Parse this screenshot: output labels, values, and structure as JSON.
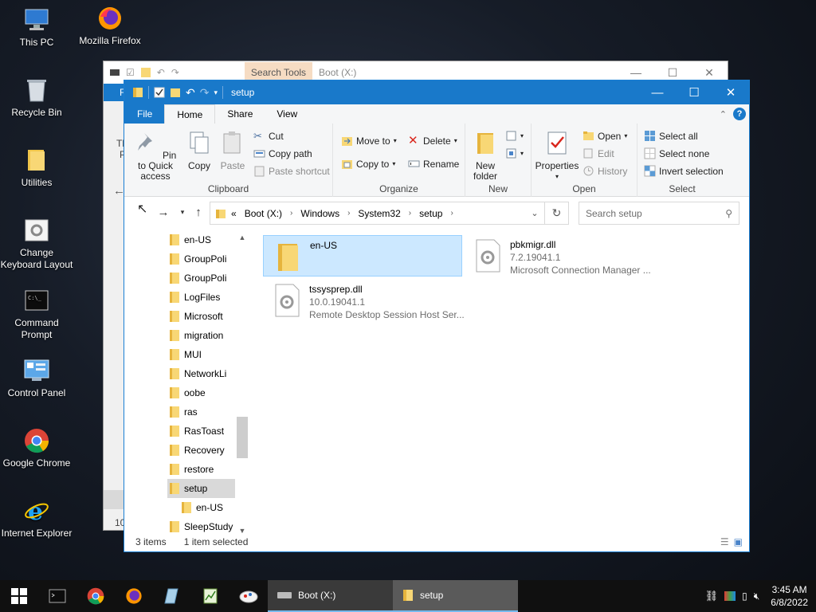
{
  "desktop": {
    "icons": [
      {
        "label": "This PC"
      },
      {
        "label": "Mozilla Firefox"
      },
      {
        "label": "Recycle Bin"
      },
      {
        "label": "Utilities"
      },
      {
        "label": "Change Keyboard Layout"
      },
      {
        "label": "Command Prompt"
      },
      {
        "label": "Control Panel"
      },
      {
        "label": "Google Chrome"
      },
      {
        "label": "Internet Explorer"
      }
    ]
  },
  "bg_window": {
    "context_tab": "Search Tools",
    "title": "Boot (X:)",
    "fragments": {
      "a": "F",
      "b": "Th",
      "c": "P",
      "d": "10"
    }
  },
  "window": {
    "title": "setup",
    "tabs": {
      "file": "File",
      "home": "Home",
      "share": "Share",
      "view": "View"
    },
    "ribbon": {
      "clipboard": {
        "name": "Clipboard",
        "pin": "Pin to Quick access",
        "copy": "Copy",
        "paste": "Paste",
        "cut": "Cut",
        "copy_path": "Copy path",
        "paste_shortcut": "Paste shortcut"
      },
      "organize": {
        "name": "Organize",
        "move_to": "Move to",
        "copy_to": "Copy to",
        "delete": "Delete",
        "rename": "Rename"
      },
      "new": {
        "name": "New",
        "new_folder": "New folder"
      },
      "open": {
        "name": "Open",
        "properties": "Properties",
        "open": "Open",
        "edit": "Edit",
        "history": "History"
      },
      "select": {
        "name": "Select",
        "select_all": "Select all",
        "select_none": "Select none",
        "invert": "Invert selection"
      }
    },
    "address": {
      "overflow": "«",
      "crumbs": [
        "Boot (X:)",
        "Windows",
        "System32",
        "setup"
      ]
    },
    "search_placeholder": "Search setup",
    "nav_items": [
      "en-US",
      "GroupPoli",
      "GroupPoli",
      "LogFiles",
      "Microsoft",
      "migration",
      "MUI",
      "NetworkLi",
      "oobe",
      "ras",
      "RasToast",
      "Recovery",
      "restore",
      "setup",
      "en-US",
      "SleepStudy"
    ],
    "files": [
      {
        "name": "en-US",
        "line1": "",
        "line2": ""
      },
      {
        "name": "pbkmigr.dll",
        "line1": "7.2.19041.1",
        "line2": "Microsoft Connection Manager ..."
      },
      {
        "name": "tssysprep.dll",
        "line1": "10.0.19041.1",
        "line2": "Remote Desktop Session Host Ser..."
      }
    ],
    "status": {
      "count": "3 items",
      "selection": "1 item selected"
    }
  },
  "taskbar": {
    "tasks": [
      {
        "label": "Boot (X:)"
      },
      {
        "label": "setup"
      }
    ],
    "time": "3:45 AM",
    "date": "6/8/2022"
  },
  "colors": {
    "accent": "#1979ca",
    "folder": "#f8d775",
    "selection": "#cce8ff"
  }
}
